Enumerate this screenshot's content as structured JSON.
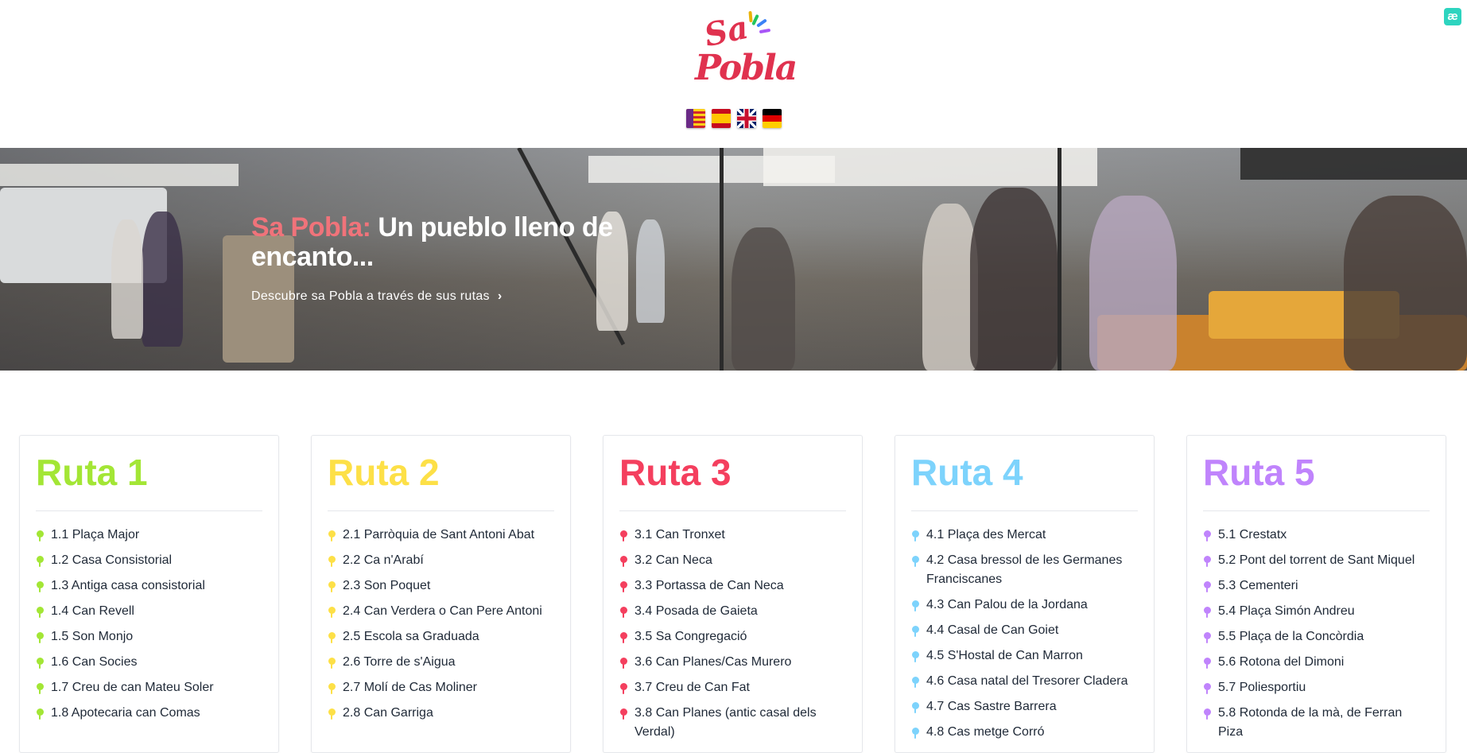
{
  "header": {
    "logo": {
      "line1": "Sa",
      "line2": "Pobla"
    },
    "languages": [
      "Català",
      "Español",
      "English",
      "Deutsch"
    ],
    "corner_button": "æ"
  },
  "hero": {
    "brand": "Sa Pobla:",
    "title": "Un pueblo lleno de encanto...",
    "link": "Descubre sa Pobla a través de sus rutas",
    "link_icon": "chevron-right-icon"
  },
  "routes": [
    {
      "title": "Ruta 1",
      "color": "#a3e635",
      "items": [
        "1.1 Plaça Major",
        "1.2 Casa Consistorial",
        "1.3 Antiga casa consistorial",
        "1.4 Can Revell",
        "1.5 Son Monjo",
        "1.6 Can Socies",
        "1.7 Creu de can Mateu Soler",
        "1.8 Apotecaria can Comas"
      ]
    },
    {
      "title": "Ruta 2",
      "color": "#fde047",
      "items": [
        "2.1 Parròquia de Sant Antoni Abat",
        "2.2 Ca n'Arabí",
        "2.3 Son Poquet",
        "2.4 Can Verdera o Can Pere Antoni",
        "2.5 Escola sa Graduada",
        "2.6 Torre de s'Aigua",
        "2.7 Molí de Cas Moliner",
        "2.8 Can Garriga"
      ]
    },
    {
      "title": "Ruta 3",
      "color": "#f43f5e",
      "items": [
        "3.1 Can Tronxet",
        "3.2 Can Neca",
        "3.3 Portassa de Can Neca",
        "3.4 Posada de Gaieta",
        "3.5 Sa Congregació",
        "3.6 Can Planes/Cas Murero",
        "3.7 Creu de Can Fat",
        "3.8 Can Planes (antic casal dels Verdal)"
      ]
    },
    {
      "title": "Ruta 4",
      "color": "#7dd3fc",
      "items": [
        "4.1 Plaça des Mercat",
        "4.2 Casa bressol de les Germanes Franciscanes",
        "4.3 Can Palou de la Jordana",
        "4.4 Casal de Can Goiet",
        "4.5 S'Hostal de Can Marron",
        "4.6 Casa natal del Tresorer Cladera",
        "4.7 Cas Sastre Barrera",
        "4.8 Cas metge Corró"
      ]
    },
    {
      "title": "Ruta 5",
      "color": "#c084fc",
      "items": [
        "5.1 Crestatx",
        "5.2 Pont del torrent de Sant Miquel",
        "5.3 Cementeri",
        "5.4 Plaça Simón Andreu",
        "5.5 Plaça de la Concòrdia",
        "5.6 Rotona del Dimoni",
        "5.7 Poliesportiu",
        "5.8 Rotonda de la mà, de Ferran Piza"
      ]
    }
  ]
}
